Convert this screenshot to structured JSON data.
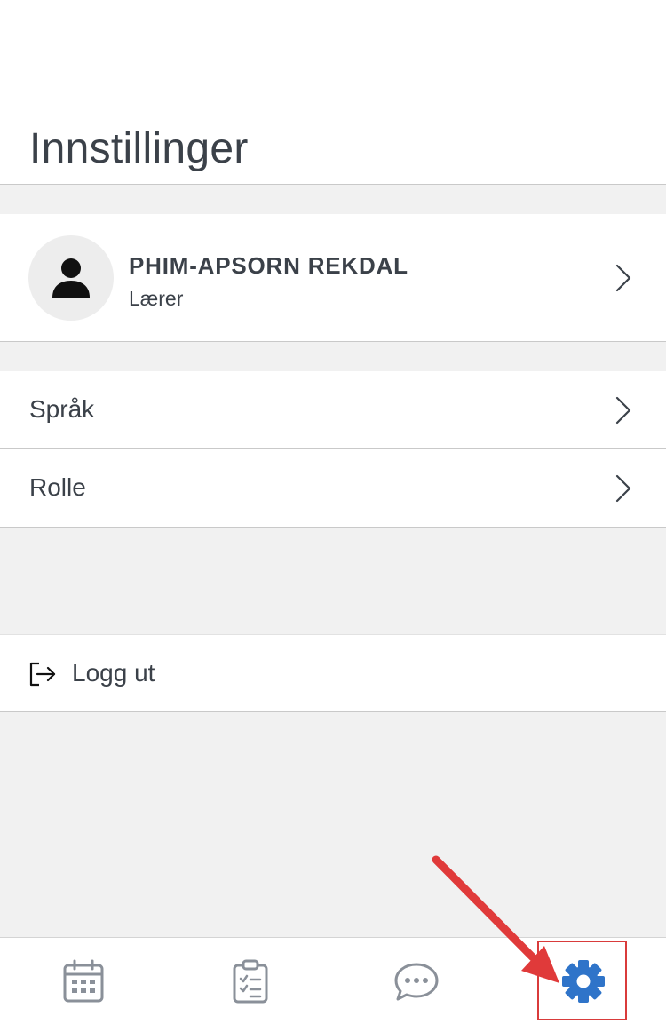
{
  "header": {
    "title": "Innstillinger"
  },
  "profile": {
    "name": "PHIM-APSORN REKDAL",
    "role": "Lærer"
  },
  "settings": {
    "items": [
      {
        "label": "Språk"
      },
      {
        "label": "Rolle"
      }
    ]
  },
  "logout": {
    "label": "Logg ut",
    "icon": "logout-icon"
  },
  "tab_bar": {
    "tabs": [
      {
        "icon": "calendar-icon",
        "active": false
      },
      {
        "icon": "clipboard-checklist-icon",
        "active": false
      },
      {
        "icon": "chat-bubble-icon",
        "active": false
      },
      {
        "icon": "gear-icon",
        "active": true
      }
    ]
  },
  "colors": {
    "active_tab": "#2f74c9",
    "inactive_tab": "#8a9099",
    "highlight": "#d93b3b",
    "background": "#f1f1f1",
    "text": "#3b4149"
  }
}
